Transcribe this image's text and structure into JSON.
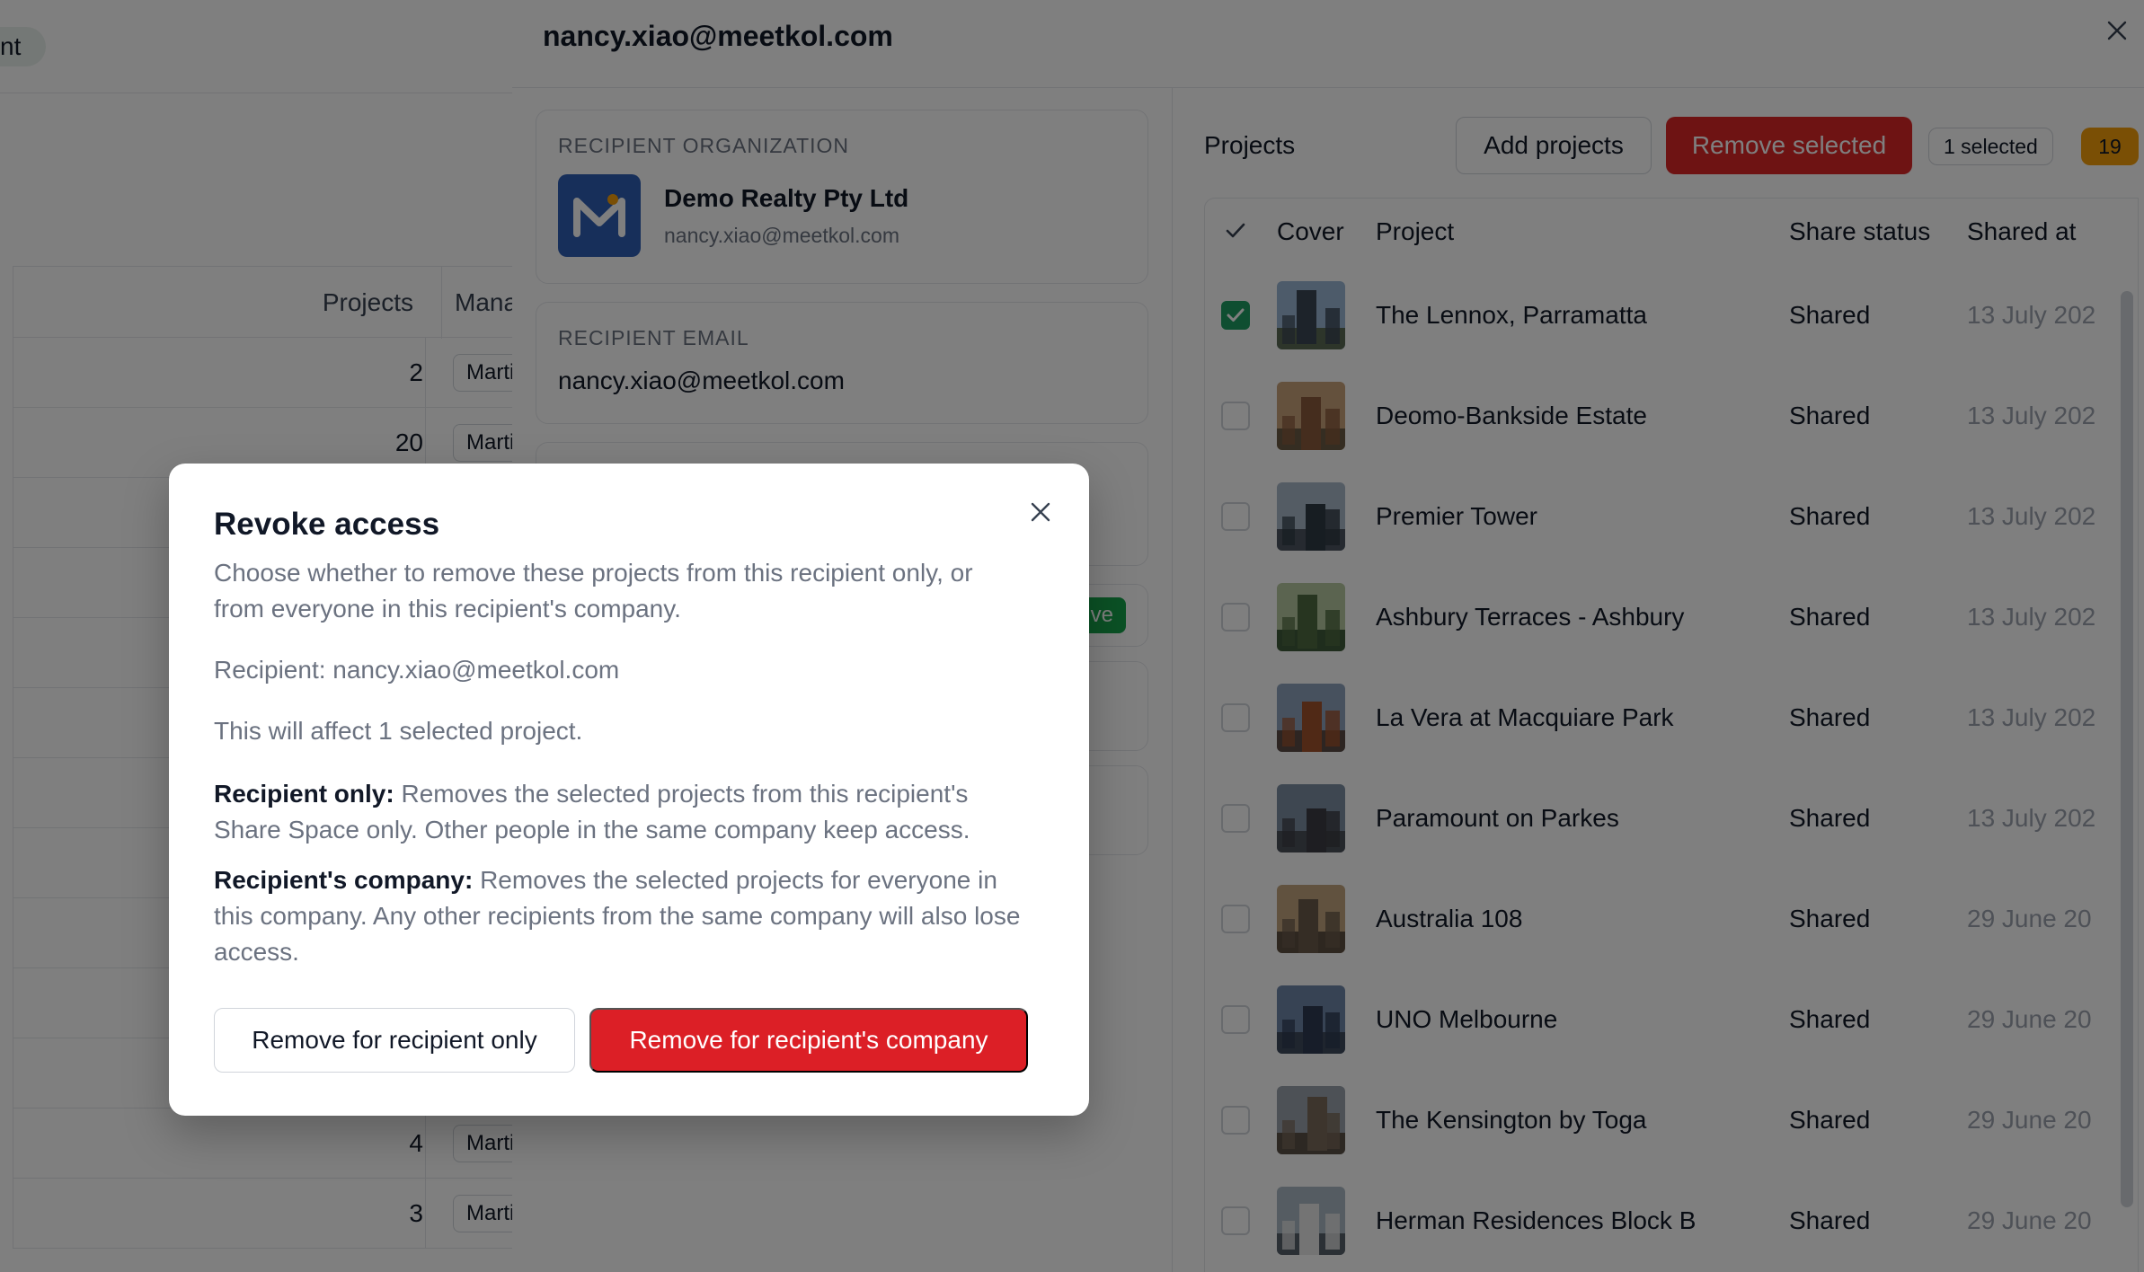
{
  "background_page": {
    "pill_text": "nt",
    "table_headers": {
      "projects": "Projects",
      "manager": "Manag"
    },
    "rows": [
      {
        "count": "2",
        "manager": "Marti"
      },
      {
        "count": "20",
        "manager": "Marti"
      },
      {
        "count": "",
        "manager": ""
      },
      {
        "count": "",
        "manager": ""
      },
      {
        "count": "",
        "manager": ""
      },
      {
        "count": "",
        "manager": ""
      },
      {
        "count": "",
        "manager": ""
      },
      {
        "count": "",
        "manager": ""
      },
      {
        "count": "",
        "manager": ""
      },
      {
        "count": "",
        "manager": ""
      },
      {
        "count": "",
        "manager": ""
      },
      {
        "count": "4",
        "manager": "Marti"
      },
      {
        "count": "3",
        "manager": "Marti"
      }
    ]
  },
  "drawer": {
    "title": "nancy.xiao@meetkol.com",
    "org_card": {
      "label": "RECIPIENT ORGANIZATION",
      "name": "Demo Realty Pty Ltd",
      "email": "nancy.xiao@meetkol.com"
    },
    "email_card": {
      "label": "RECIPIENT EMAIL",
      "value": "nancy.xiao@meetkol.com"
    },
    "status_tag": "ve",
    "projects": {
      "title": "Projects",
      "add_label": "Add projects",
      "remove_label": "Remove selected",
      "selected_label": "1 selected",
      "count": "19",
      "columns": {
        "cover": "Cover",
        "project": "Project",
        "status": "Share status",
        "shared_at": "Shared at"
      },
      "rows": [
        {
          "name": "The Lennox, Parramatta",
          "status": "Shared",
          "date": "13 July 202",
          "checked": true
        },
        {
          "name": "Deomo-Bankside Estate",
          "status": "Shared",
          "date": "13 July 202",
          "checked": false
        },
        {
          "name": "Premier Tower",
          "status": "Shared",
          "date": "13 July 202",
          "checked": false
        },
        {
          "name": "Ashbury Terraces - Ashbury",
          "status": "Shared",
          "date": "13 July 202",
          "checked": false
        },
        {
          "name": "La Vera at Macquiare Park",
          "status": "Shared",
          "date": "13 July 202",
          "checked": false
        },
        {
          "name": "Paramount on Parkes",
          "status": "Shared",
          "date": "13 July 202",
          "checked": false
        },
        {
          "name": "Australia 108",
          "status": "Shared",
          "date": "29 June 20",
          "checked": false
        },
        {
          "name": "UNO Melbourne",
          "status": "Shared",
          "date": "29 June 20",
          "checked": false
        },
        {
          "name": "The Kensington by Toga",
          "status": "Shared",
          "date": "29 June 20",
          "checked": false
        },
        {
          "name": "Herman Residences Block B",
          "status": "Shared",
          "date": "29 June 20",
          "checked": false
        }
      ]
    }
  },
  "modal": {
    "title": "Revoke access",
    "description": "Choose whether to remove these projects from this recipient only, or from everyone in this recipient's company.",
    "recipient_line": "Recipient: nancy.xiao@meetkol.com",
    "affect_line": "This will affect 1 selected project.",
    "option_recipient": {
      "label": "Recipient only:",
      "text": " Removes the selected projects from this recipient's Share Space only. Other people in the same company keep access."
    },
    "option_company": {
      "label": "Recipient's company:",
      "text": " Removes the selected projects for everyone in this company. Any other recipients from the same company will also lose access."
    },
    "btn_recipient_only": "Remove for recipient only",
    "btn_company": "Remove for recipient's company"
  },
  "colors": {
    "danger": "#dc2626",
    "success": "#1f9d63",
    "accent_orange": "#f59e0b",
    "logo_blue": "#2f5fb5"
  }
}
